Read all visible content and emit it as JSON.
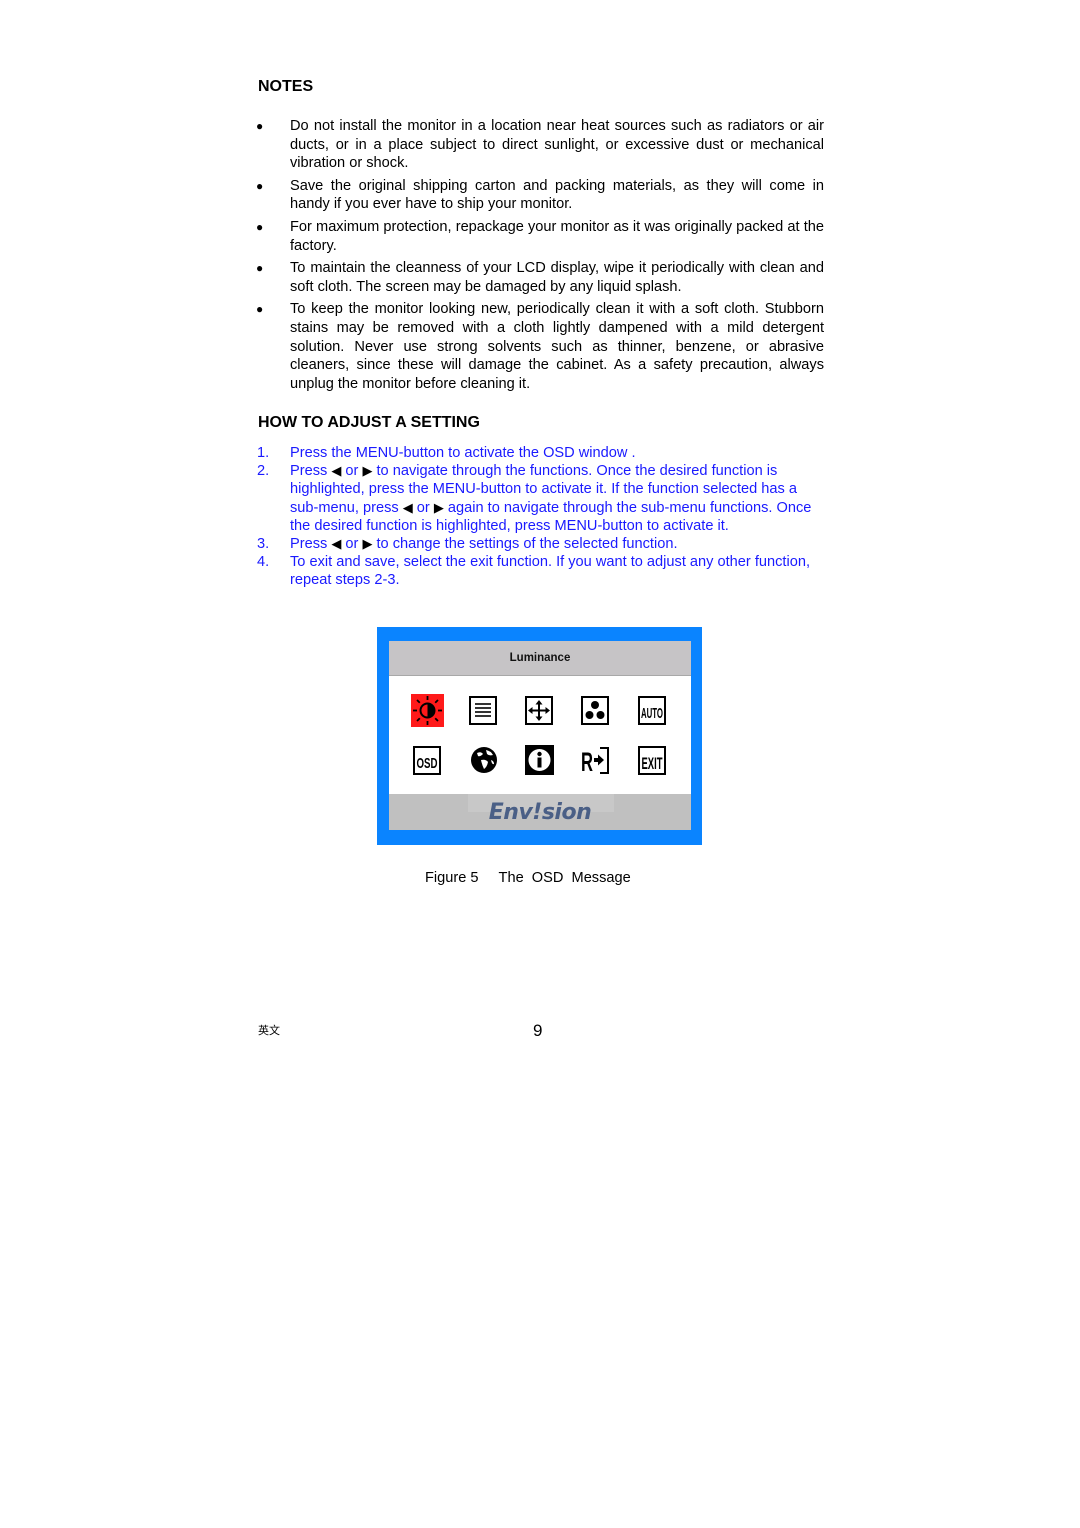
{
  "notes": {
    "heading": "NOTES",
    "bullet_glyph": "●",
    "items": [
      "Do not install the monitor in a location near heat sources such as radiators or air ducts, or in a place subject to direct sunlight, or excessive dust or mechanical vibration or shock.",
      "Save the original shipping carton and packing materials, as they will come in handy if you ever have to ship your monitor.",
      "For maximum protection, repackage your monitor as it was originally packed at the factory.",
      "To maintain the cleanness of your LCD display, wipe it periodically with clean and soft cloth. The screen may be damaged by any liquid splash.",
      "To keep the monitor looking new, periodically clean it with a soft cloth. Stubborn stains may be removed with a cloth lightly dampened with a mild detergent solution. Never use strong solvents such as thinner, benzene, or abrasive cleaners, since these will damage the cabinet. As a safety precaution, always unplug the monitor before cleaning it."
    ]
  },
  "adjust": {
    "heading": "HOW TO ADJUST A SETTING",
    "text_color": "#1a1aff",
    "left_arrow": "◀",
    "right_arrow": "▶",
    "steps": [
      {
        "num": "1.",
        "parts": [
          "Press the MENU-button to activate the OSD window ."
        ]
      },
      {
        "num": "2.",
        "parts": [
          "Press ",
          "LEFT",
          " or ",
          "RIGHT",
          " to navigate through the functions. Once the desired function is highlighted, press the MENU-button  to activate it.  If the function selected has a sub-menu, press ",
          "LEFT",
          " or ",
          "RIGHT",
          " again to navigate through the sub-menu functions.  Once the desired function is highlighted, press MENU-button to activate it."
        ]
      },
      {
        "num": "3.",
        "parts": [
          "Press ",
          "LEFT",
          " or ",
          "RIGHT",
          " to change the settings of the selected function."
        ]
      },
      {
        "num": "4.",
        "parts": [
          "To exit and save, select the exit function. If you want to adjust any other function, repeat steps 2-3."
        ]
      }
    ]
  },
  "osd": {
    "title": "Luminance",
    "brand": "Env!sion",
    "frame_color": "#0a84ff",
    "selected_color": "#ff1a1a",
    "icons": [
      {
        "name": "luminance-icon",
        "selected": true
      },
      {
        "name": "image-setup-icon",
        "selected": false
      },
      {
        "name": "position-icon",
        "selected": false
      },
      {
        "name": "color-icon",
        "selected": false
      },
      {
        "name": "auto-adjust-icon",
        "label": "AUTO",
        "selected": false
      },
      {
        "name": "osd-setting-icon",
        "label": "OSD",
        "selected": false
      },
      {
        "name": "language-globe-icon",
        "selected": false
      },
      {
        "name": "information-icon",
        "selected": false
      },
      {
        "name": "reset-icon",
        "selected": false
      },
      {
        "name": "exit-icon",
        "label": "EXIT",
        "selected": false
      }
    ]
  },
  "figure": {
    "caption": "Figure 5     The  OSD  Message"
  },
  "footer": {
    "language_label": "英文",
    "page_number": "9"
  }
}
